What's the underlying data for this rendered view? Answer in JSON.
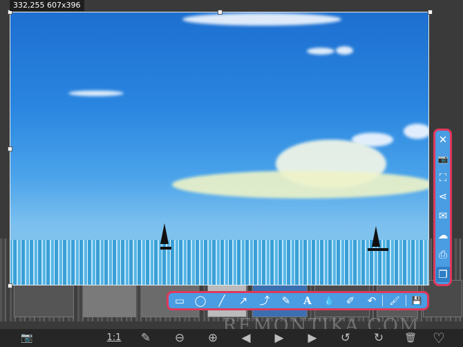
{
  "app": {
    "size_label": "332,255 607x396",
    "watermark": "REMONTIKA.COM"
  },
  "side_toolbar": {
    "items": [
      {
        "name": "close-button",
        "icon": "close-icon",
        "glyph": "✕"
      },
      {
        "name": "camera-button",
        "icon": "camera-icon",
        "glyph": "📷"
      },
      {
        "name": "crop-button",
        "icon": "crop-icon",
        "glyph": "⛶"
      },
      {
        "name": "share-button",
        "icon": "share-icon",
        "glyph": "⋖"
      },
      {
        "name": "email-button",
        "icon": "mail-icon",
        "glyph": "✉"
      },
      {
        "name": "upload-button",
        "icon": "cloud-upload-icon",
        "glyph": "☁"
      },
      {
        "name": "print-button",
        "icon": "printer-icon",
        "glyph": "⎙"
      },
      {
        "name": "copy-button",
        "icon": "copy-icon",
        "glyph": "❐"
      }
    ]
  },
  "draw_toolbar": {
    "items": [
      {
        "name": "rectangle-tool",
        "icon": "rectangle-icon",
        "glyph": "▭"
      },
      {
        "name": "ellipse-tool",
        "icon": "ellipse-icon",
        "glyph": "◯"
      },
      {
        "name": "line-tool",
        "icon": "line-icon",
        "glyph": "╱"
      },
      {
        "name": "arrow-tool",
        "icon": "arrow-icon",
        "glyph": "↗"
      },
      {
        "name": "curve-arrow-tool",
        "icon": "curve-arrow-icon",
        "glyph": "⤴"
      },
      {
        "name": "pencil-tool",
        "icon": "pencil-icon",
        "glyph": "✎"
      },
      {
        "name": "text-tool",
        "icon": "text-icon",
        "glyph": "A"
      },
      {
        "name": "blur-tool",
        "icon": "drop-icon",
        "glyph": "💧"
      },
      {
        "name": "highlighter-tool",
        "icon": "marker-icon",
        "glyph": "✐"
      },
      {
        "name": "undo-button",
        "icon": "undo-icon",
        "glyph": "↶"
      },
      {
        "name": "color-button",
        "icon": "brush-icon",
        "glyph": "🖌"
      },
      {
        "name": "save-button",
        "icon": "floppy-icon",
        "glyph": "💾"
      }
    ]
  },
  "bottom_bar": {
    "items": [
      {
        "name": "screenshot-button",
        "icon": "camera-icon",
        "glyph": "📷"
      },
      {
        "name": "actual-size-button",
        "label": "1:1"
      },
      {
        "name": "edit-button",
        "icon": "edit-icon",
        "glyph": "✎"
      },
      {
        "name": "zoom-out-button",
        "icon": "zoom-out-icon",
        "glyph": "⊖"
      },
      {
        "name": "zoom-in-button",
        "icon": "zoom-in-icon",
        "glyph": "⊕"
      },
      {
        "name": "previous-button",
        "icon": "previous-icon",
        "glyph": "◀"
      },
      {
        "name": "slideshow-button",
        "icon": "slideshow-icon",
        "glyph": "▶"
      },
      {
        "name": "next-button",
        "icon": "next-icon",
        "glyph": "▶"
      },
      {
        "name": "rotate-left-button",
        "icon": "rotate-left-icon",
        "glyph": "↺"
      },
      {
        "name": "rotate-right-button",
        "icon": "rotate-right-icon",
        "glyph": "↻"
      },
      {
        "name": "delete-button",
        "icon": "trash-icon",
        "glyph": "🗑"
      },
      {
        "name": "favorite-button",
        "icon": "heart-icon",
        "glyph": "♡"
      }
    ]
  },
  "colors": {
    "toolbar_fill": "#4a9de2",
    "toolbar_border": "#e0385a",
    "size_label_bg": "#1e1e1e"
  }
}
